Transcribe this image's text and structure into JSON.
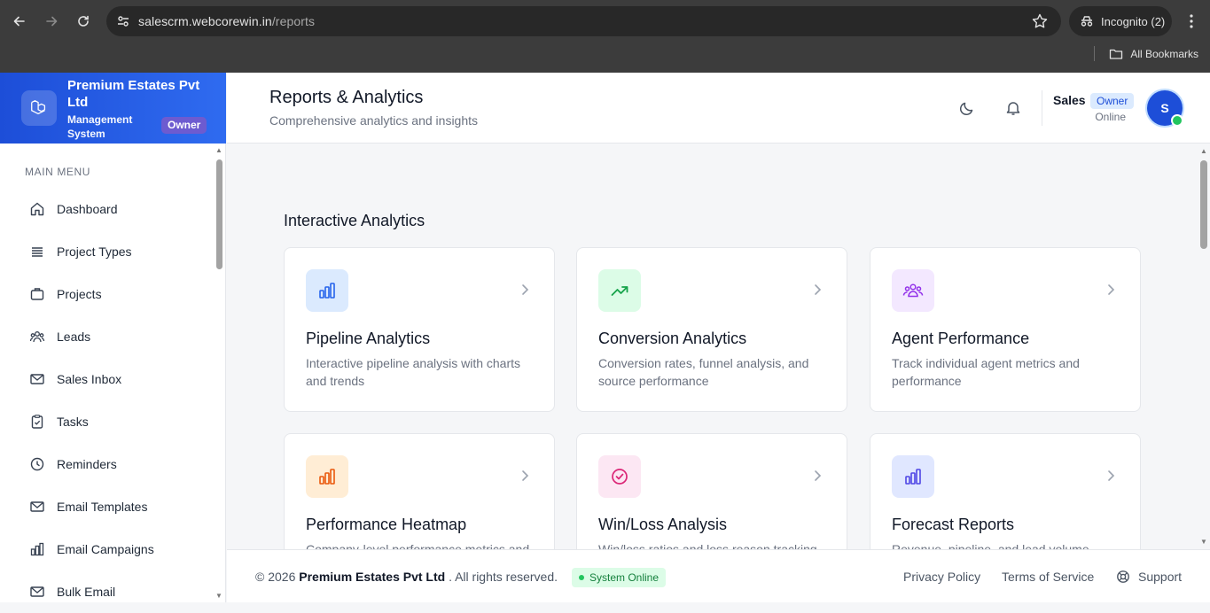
{
  "browser": {
    "url_host": "salescrm.webcorewin.in",
    "url_path": "/reports",
    "incognito_label": "Incognito (2)",
    "bookmarks_label": "All Bookmarks"
  },
  "brand": {
    "name": "Premium Estates Pvt Ltd",
    "subtitle": "Management System",
    "role_badge": "Owner"
  },
  "sidebar": {
    "section_label": "MAIN MENU",
    "items": [
      {
        "label": "Dashboard",
        "icon": "home-icon"
      },
      {
        "label": "Project Types",
        "icon": "list-icon"
      },
      {
        "label": "Projects",
        "icon": "briefcase-icon"
      },
      {
        "label": "Leads",
        "icon": "users-icon"
      },
      {
        "label": "Sales Inbox",
        "icon": "mail-icon"
      },
      {
        "label": "Tasks",
        "icon": "clipboard-check-icon"
      },
      {
        "label": "Reminders",
        "icon": "clock-icon"
      },
      {
        "label": "Email Templates",
        "icon": "mail-icon"
      },
      {
        "label": "Email Campaigns",
        "icon": "bar-chart-icon"
      },
      {
        "label": "Bulk Email",
        "icon": "mail-icon"
      }
    ]
  },
  "header": {
    "title": "Reports & Analytics",
    "subtitle": "Comprehensive analytics and insights",
    "user_name": "Sales",
    "user_role": "Owner",
    "user_status": "Online",
    "avatar_initial": "S"
  },
  "main": {
    "section_title": "Interactive Analytics",
    "cards": [
      {
        "title": "Pipeline Analytics",
        "desc": "Interactive pipeline analysis with charts and trends",
        "icon": "bar-chart-icon",
        "bg": "#dbeafe",
        "fg": "#2563eb"
      },
      {
        "title": "Conversion Analytics",
        "desc": "Conversion rates, funnel analysis, and source performance",
        "icon": "trending-up-icon",
        "bg": "#dcfce7",
        "fg": "#16a34a"
      },
      {
        "title": "Agent Performance",
        "desc": "Track individual agent metrics and performance",
        "icon": "users-icon",
        "bg": "#f3e8ff",
        "fg": "#9333ea"
      },
      {
        "title": "Performance Heatmap",
        "desc": "Company-level performance metrics and",
        "icon": "bar-chart-icon",
        "bg": "#ffedd5",
        "fg": "#ea580c"
      },
      {
        "title": "Win/Loss Analysis",
        "desc": "Win/loss ratios and loss reason tracking",
        "icon": "check-circle-icon",
        "bg": "#fce7f3",
        "fg": "#db2777"
      },
      {
        "title": "Forecast Reports",
        "desc": "Revenue, pipeline, and lead volume",
        "icon": "bar-chart-icon",
        "bg": "#e0e7ff",
        "fg": "#4f46e5"
      }
    ]
  },
  "footer": {
    "copyright_prefix": "© 2026",
    "company": "Premium Estates Pvt Ltd",
    "copyright_suffix": ". All rights reserved.",
    "system_status": "System Online",
    "links": [
      "Privacy Policy",
      "Terms of Service",
      "Support"
    ]
  }
}
